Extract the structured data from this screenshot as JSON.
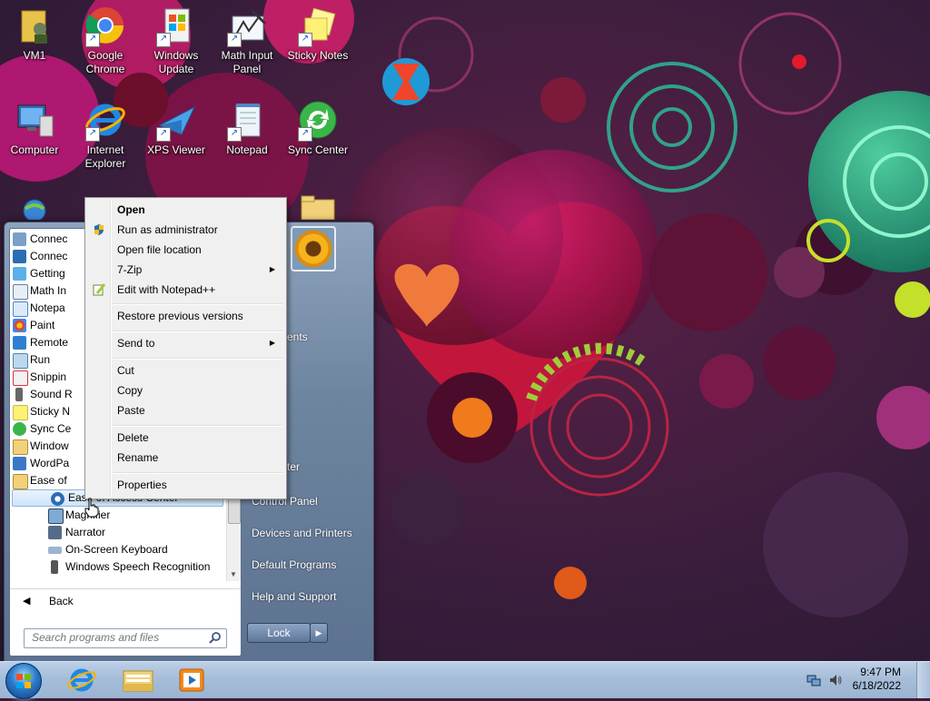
{
  "desktop": {
    "icons": [
      {
        "label": "VM1"
      },
      {
        "label": "Google Chrome"
      },
      {
        "label": "Windows Update"
      },
      {
        "label": "Math Input Panel"
      },
      {
        "label": "Sticky Notes"
      },
      {
        "label": "Computer"
      },
      {
        "label": "Internet Explorer"
      },
      {
        "label": "XPS Viewer"
      },
      {
        "label": "Notepad"
      },
      {
        "label": "Sync Center"
      }
    ]
  },
  "start_menu": {
    "programs": [
      {
        "label": "Connec",
        "icon": "remote-connection-icon"
      },
      {
        "label": "Connec",
        "icon": "projector-connection-icon"
      },
      {
        "label": "Getting",
        "icon": "getting-started-icon"
      },
      {
        "label": "Math In",
        "icon": "math-input-icon"
      },
      {
        "label": "Notepa",
        "icon": "notepad-icon"
      },
      {
        "label": "Paint",
        "icon": "paint-icon"
      },
      {
        "label": "Remote",
        "icon": "remote-desktop-icon"
      },
      {
        "label": "Run",
        "icon": "run-icon"
      },
      {
        "label": "Snippin",
        "icon": "snipping-tool-icon"
      },
      {
        "label": "Sound R",
        "icon": "microphone-icon"
      },
      {
        "label": "Sticky N",
        "icon": "sticky-notes-icon"
      },
      {
        "label": "Sync Ce",
        "icon": "sync-center-icon"
      },
      {
        "label": "Window",
        "icon": "windows-explorer-icon"
      },
      {
        "label": "WordPa",
        "icon": "wordpad-icon"
      },
      {
        "label": "Ease of",
        "icon": "folder-icon"
      },
      {
        "label": "Ease of Access Center",
        "icon": "ease-of-access-icon"
      },
      {
        "label": "Magnifier",
        "icon": "magnifier-icon"
      },
      {
        "label": "Narrator",
        "icon": "narrator-icon"
      },
      {
        "label": "On-Screen Keyboard",
        "icon": "keyboard-icon"
      },
      {
        "label": "Windows Speech Recognition",
        "icon": "speech-recognition-icon"
      }
    ],
    "back_label": "Back",
    "search_placeholder": "Search programs and files",
    "right_items": [
      {
        "label": "ents"
      },
      {
        "label": "ter"
      },
      {
        "label": "Control Panel"
      },
      {
        "label": "Devices and Printers"
      },
      {
        "label": "Default Programs"
      },
      {
        "label": "Help and Support"
      }
    ],
    "lock_label": "Lock"
  },
  "context_menu": {
    "items": [
      {
        "label": "Open",
        "bold": true
      },
      {
        "label": "Run as administrator",
        "icon": "uac-shield-icon"
      },
      {
        "label": "Open file location"
      },
      {
        "label": "7-Zip",
        "submenu": true
      },
      {
        "label": "Edit with Notepad++",
        "icon": "notepad-plus-plus-icon"
      },
      {
        "label": "Restore previous versions"
      },
      {
        "label": "Send to",
        "submenu": true
      },
      {
        "label": "Cut"
      },
      {
        "label": "Copy"
      },
      {
        "label": "Paste"
      },
      {
        "label": "Delete"
      },
      {
        "label": "Rename"
      },
      {
        "label": "Properties"
      }
    ]
  },
  "taskbar": {
    "pinned": [
      "internet-explorer-icon",
      "windows-explorer-icon",
      "media-player-icon"
    ],
    "time": "9:47 PM",
    "date": "6/18/2022"
  },
  "colors": {
    "taskbar": "#a6bdd8",
    "start_menu_frame": "#6e859f",
    "highlight": "#cfe4f9"
  }
}
